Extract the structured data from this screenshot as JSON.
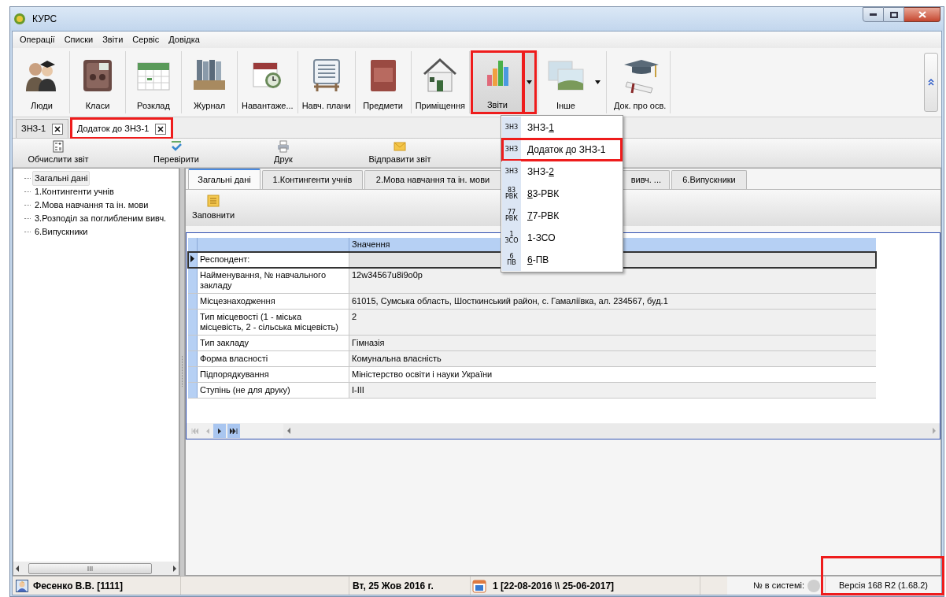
{
  "window": {
    "title": "КУРС"
  },
  "menu": [
    "Операції",
    "Списки",
    "Звіти",
    "Сервіс",
    "Довідка"
  ],
  "ribbon": [
    {
      "label": "Люди",
      "dropdown": false,
      "pressed": false,
      "highlighted": false
    },
    {
      "label": "Класи",
      "dropdown": false,
      "pressed": false,
      "highlighted": false
    },
    {
      "label": "Розклад",
      "dropdown": false,
      "pressed": false,
      "highlighted": false
    },
    {
      "label": "Журнал",
      "dropdown": false,
      "pressed": false,
      "highlighted": false
    },
    {
      "label": "Навантаже...",
      "dropdown": false,
      "pressed": false,
      "highlighted": false
    },
    {
      "label": "Навч. плани",
      "dropdown": false,
      "pressed": false,
      "highlighted": false
    },
    {
      "label": "Предмети",
      "dropdown": false,
      "pressed": false,
      "highlighted": false
    },
    {
      "label": "Приміщення",
      "dropdown": false,
      "pressed": false,
      "highlighted": false
    },
    {
      "label": "Звіти",
      "dropdown": true,
      "pressed": true,
      "highlighted": true
    },
    {
      "label": "Інше",
      "dropdown": true,
      "pressed": false,
      "highlighted": false
    },
    {
      "label": "Док. про осв.",
      "dropdown": false,
      "pressed": false,
      "highlighted": false
    }
  ],
  "doc_tabs": [
    {
      "label": "ЗНЗ-1",
      "selected": false,
      "highlighted": false
    },
    {
      "label": "Додаток до ЗНЗ-1",
      "selected": true,
      "highlighted": true
    }
  ],
  "actions": [
    "Обчислити звіт",
    "Перевірити",
    "Друк",
    "Відправити звіт"
  ],
  "tree": [
    {
      "label": "Загальні дані",
      "selected": true
    },
    {
      "label": "1.Контингенти учнів",
      "selected": false
    },
    {
      "label": "2.Мова навчання та ін. мови",
      "selected": false
    },
    {
      "label": "3.Розподіл за поглибленим вивч.",
      "selected": false
    },
    {
      "label": "6.Випускники",
      "selected": false
    }
  ],
  "content_tabs": [
    {
      "label": "Загальні дані",
      "selected": true
    },
    {
      "label": "1.Контингенти учнів",
      "selected": false
    },
    {
      "label": "2.Мова навчання та ін. мови",
      "selected": false
    },
    {
      "label": "вивч. ...",
      "selected": false
    },
    {
      "label": "6.Випускники",
      "selected": false
    }
  ],
  "fill_button": "Заповнити",
  "grid": {
    "value_column": "Значення",
    "rows": [
      {
        "label": "Респондент:",
        "current": true,
        "shaded": true
      },
      {
        "label": "Найменування, № навчального закладу",
        "value": "12w34567u8i9o0p",
        "current": false,
        "shaded": true
      },
      {
        "label": "Місцезнаходження",
        "value": "61015, Сумська область, Шосткинський район, с. Гамаліївка, ал. 234567, буд.1",
        "current": false,
        "shaded": true
      },
      {
        "label": "Тип місцевості (1 - міська місцевість, 2 - сільська місцевість)",
        "value": "2",
        "current": false,
        "shaded": true
      },
      {
        "label": "Тип закладу",
        "value": "Гімназія",
        "current": false,
        "shaded": true
      },
      {
        "label": "Форма власності",
        "value": "Комунальна власність",
        "current": false,
        "shaded": true
      },
      {
        "label": "Підпорядкування",
        "value": "Міністерство освіти і науки України",
        "current": false,
        "shaded": false
      },
      {
        "label": "Ступінь (не для друку)",
        "value": "І-ІІІ",
        "current": false,
        "shaded": true
      }
    ]
  },
  "reports_menu": [
    {
      "badge": [
        "ЗНЗ"
      ],
      "prefix": "ЗНЗ-",
      "key": "1",
      "highlighted": false
    },
    {
      "badge": [
        "ЗНЗ"
      ],
      "prefix": "Додаток до ЗНЗ-1",
      "highlighted": true
    },
    {
      "badge": [
        "ЗНЗ"
      ],
      "prefix": "ЗНЗ-",
      "key": "2",
      "highlighted": false
    },
    {
      "badge": [
        "83",
        "РВК"
      ],
      "key": "8",
      "suffix": "3-РВК",
      "highlighted": false
    },
    {
      "badge": [
        "77",
        "РВК"
      ],
      "key": "7",
      "suffix": "7-РВК",
      "highlighted": false
    },
    {
      "badge": [
        "1",
        "ЗСО"
      ],
      "prefix": "1-ЗСО",
      "highlighted": false
    },
    {
      "badge": [
        "6",
        "ПВ"
      ],
      "key": "6",
      "suffix": "-ПВ",
      "highlighted": false
    }
  ],
  "status_bar": {
    "user": "Фесенко В.В. [1111]",
    "date": "Вт, 25 Жов 2016 г.",
    "period": "1 [22-08-2016 \\\\ 25-06-2017]",
    "system_label": "№ в системі:",
    "version": "Версія 168 R2 (1.68.2)",
    "version_highlighted": true
  }
}
